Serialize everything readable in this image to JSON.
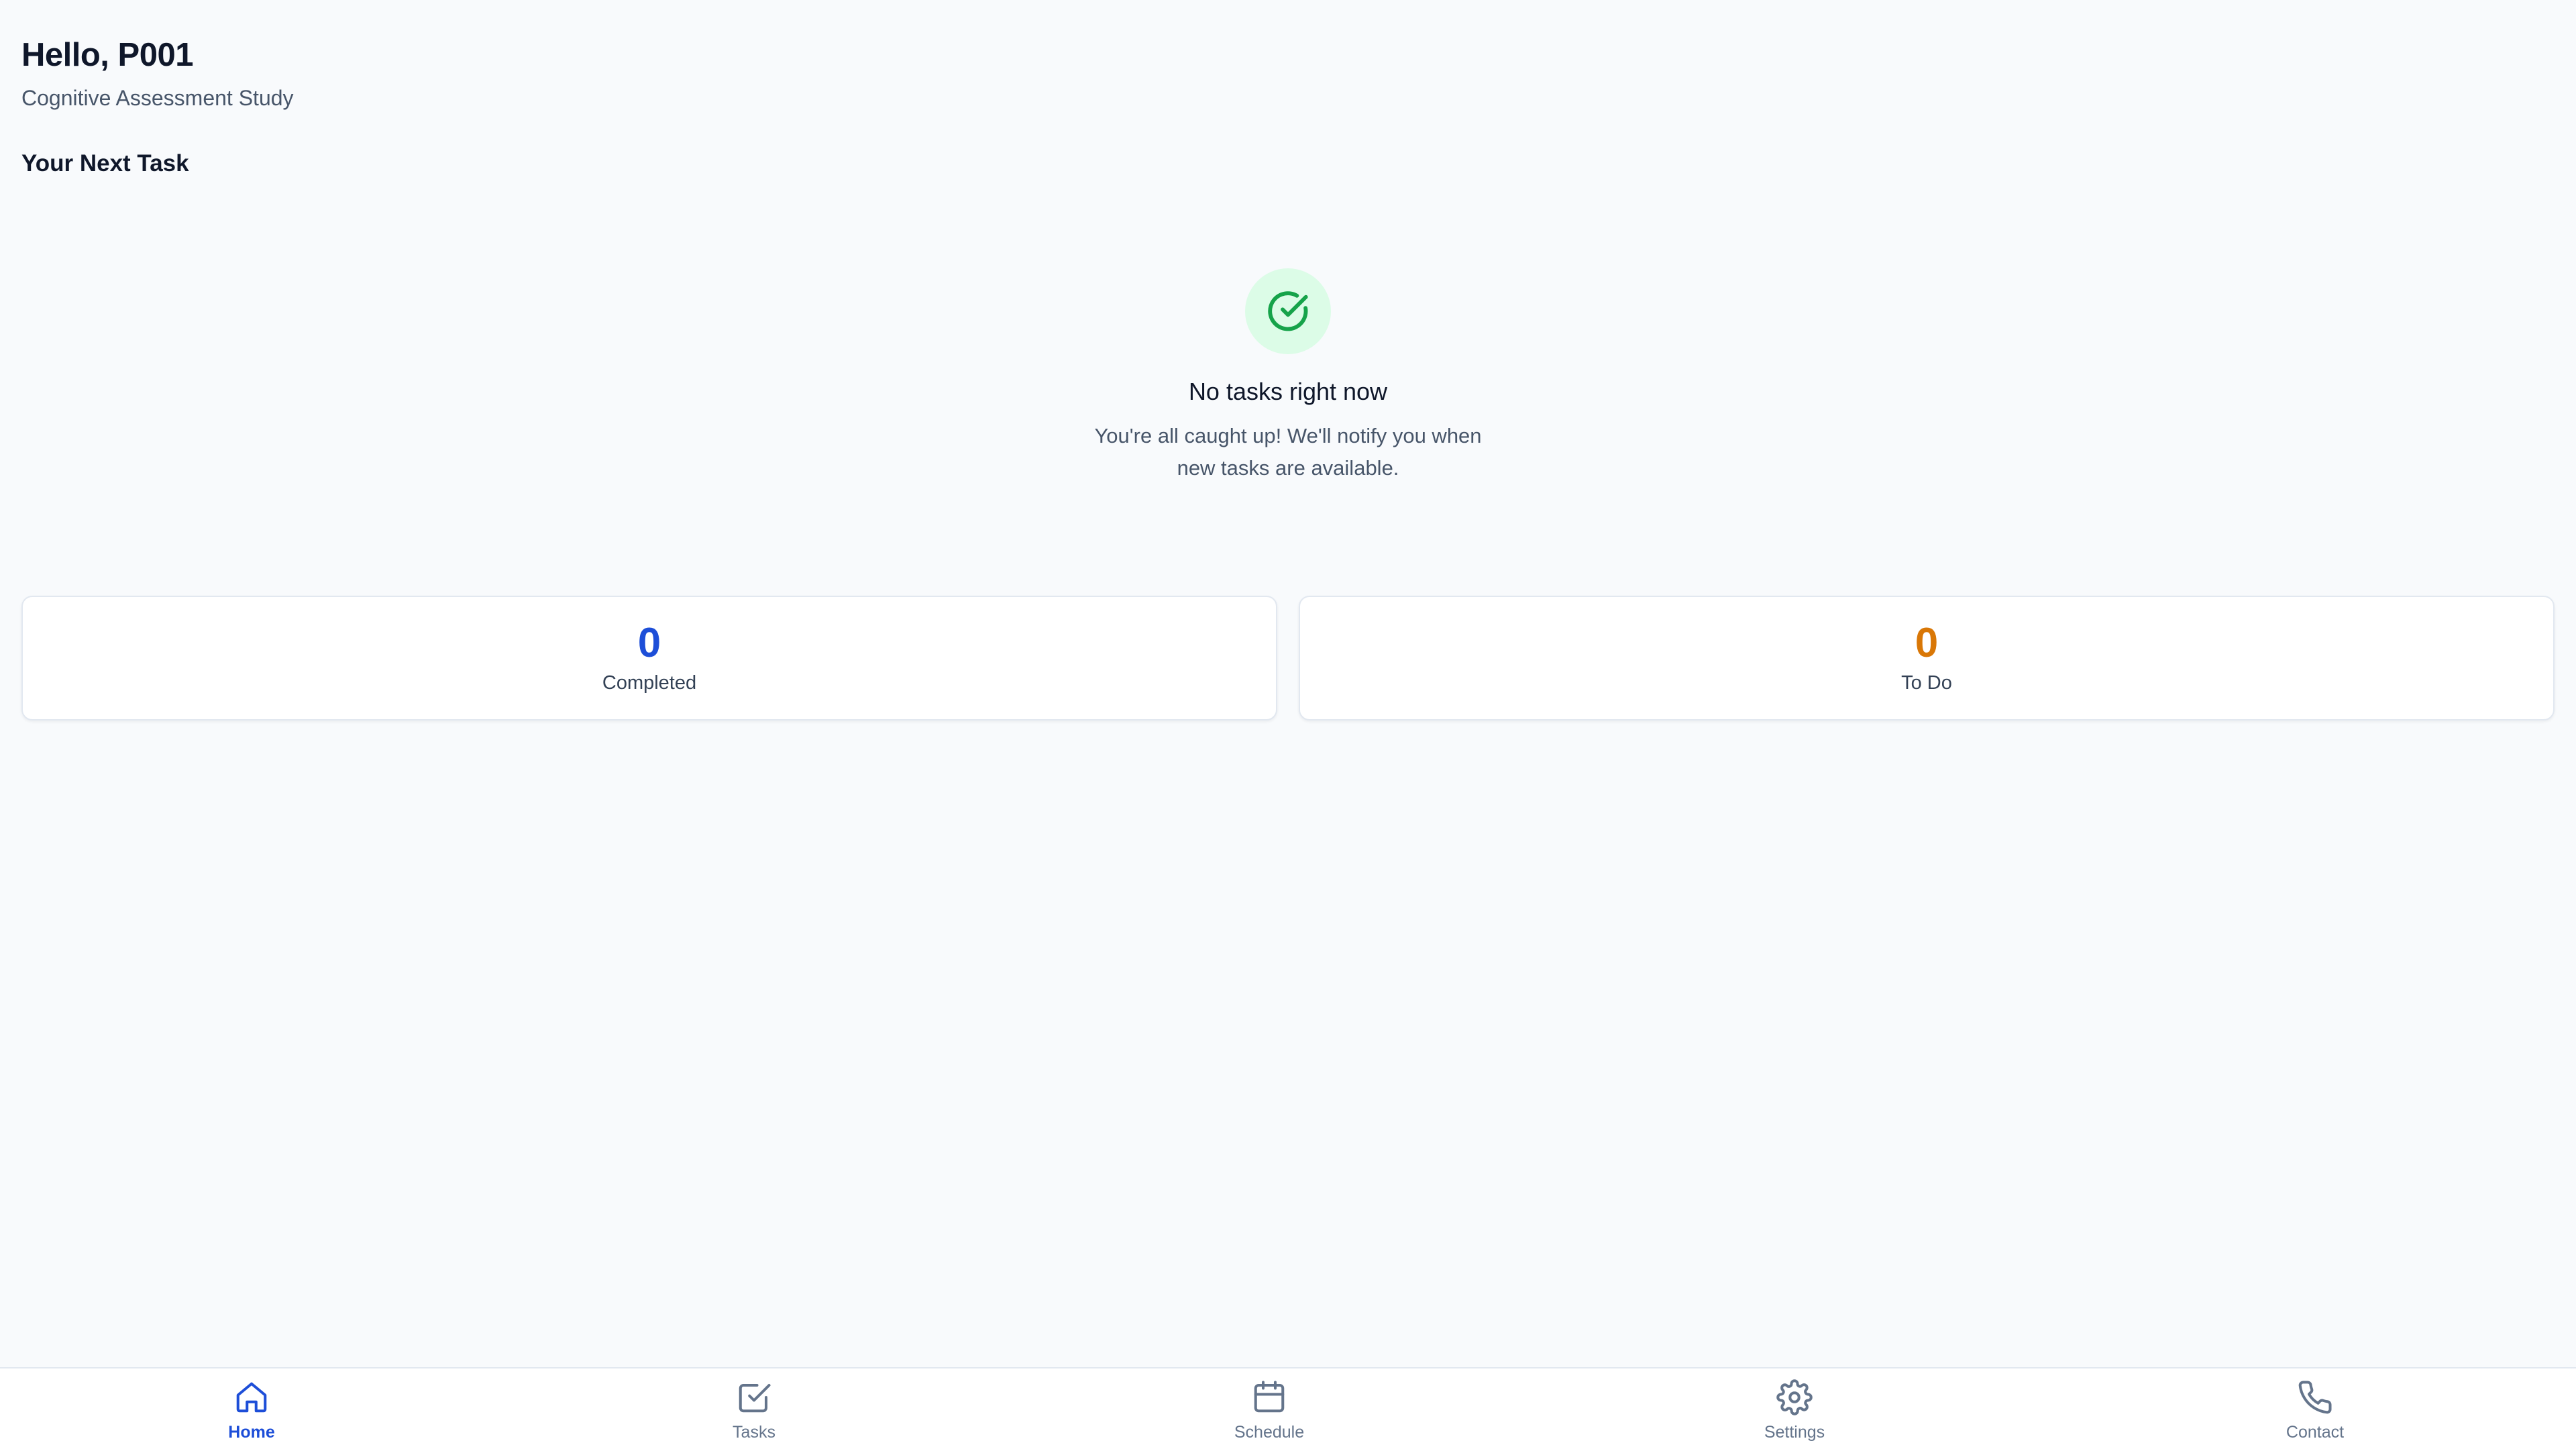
{
  "header": {
    "greeting": "Hello, P001",
    "study_name": "Cognitive Assessment Study"
  },
  "next_task": {
    "section_title": "Your Next Task",
    "empty_state": {
      "icon": "check-circle-icon",
      "title": "No tasks right now",
      "description": "You're all caught up! We'll notify you when new tasks are available."
    }
  },
  "stats": [
    {
      "value": "0",
      "label": "Completed",
      "color": "#1d4ed8"
    },
    {
      "value": "0",
      "label": "To Do",
      "color": "#d97706"
    }
  ],
  "bottom_nav": {
    "active": "Home",
    "items": [
      {
        "label": "Home",
        "icon": "home-icon"
      },
      {
        "label": "Tasks",
        "icon": "checkbox-icon"
      },
      {
        "label": "Schedule",
        "icon": "calendar-icon"
      },
      {
        "label": "Settings",
        "icon": "gear-icon"
      },
      {
        "label": "Contact",
        "icon": "phone-icon"
      }
    ]
  },
  "colors": {
    "background": "#f8fafc",
    "accent": "#1d4ed8",
    "success": "#16a34a",
    "success_bg": "#dcfce7",
    "warning": "#d97706",
    "muted_text": "#64748b"
  }
}
